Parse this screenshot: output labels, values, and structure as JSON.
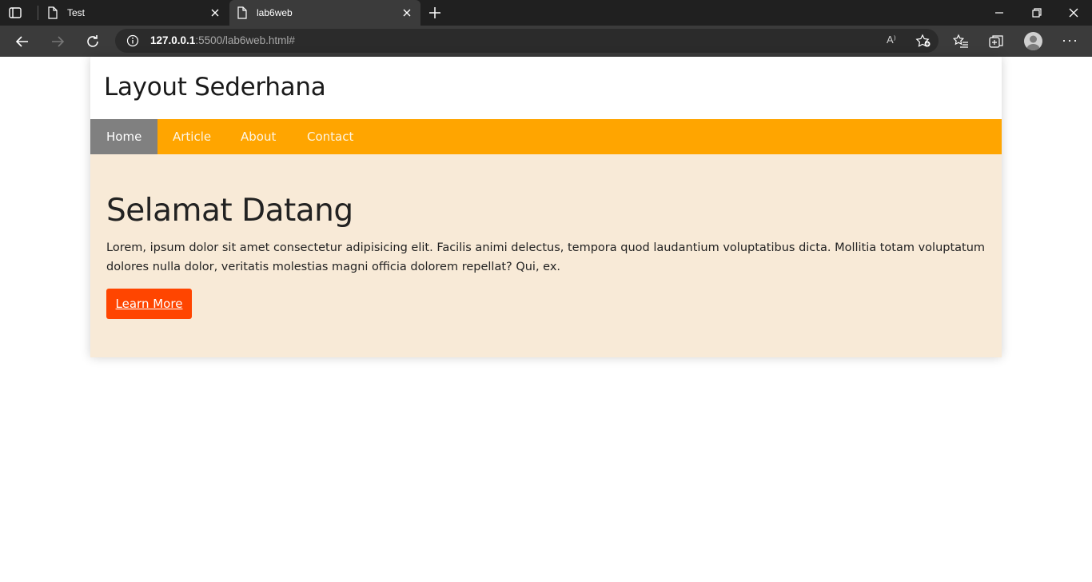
{
  "browser": {
    "tabs": [
      {
        "title": "Test",
        "active": false
      },
      {
        "title": "lab6web",
        "active": true
      }
    ],
    "address": {
      "host": "127.0.0.1",
      "rest": ":5500/lab6web.html#"
    },
    "read_aloud": "A⁾"
  },
  "site": {
    "title": "Layout Sederhana",
    "nav": [
      {
        "label": "Home",
        "active": true
      },
      {
        "label": "Article",
        "active": false
      },
      {
        "label": "About",
        "active": false
      },
      {
        "label": "Contact",
        "active": false
      }
    ],
    "hero": {
      "heading": "Selamat Datang",
      "text": "Lorem, ipsum dolor sit amet consectetur adipisicing elit. Facilis animi delectus, tempora quod laudantium voluptatibus dicta. Mollitia totam voluptatum dolores nulla dolor, veritatis molestias magni officia dolorem repellat? Qui, ex.",
      "button": "Learn More"
    }
  },
  "colors": {
    "nav_bg": "#ffa500",
    "nav_active": "#808080",
    "hero_bg": "#f8ead7",
    "button": "#ff4500"
  }
}
